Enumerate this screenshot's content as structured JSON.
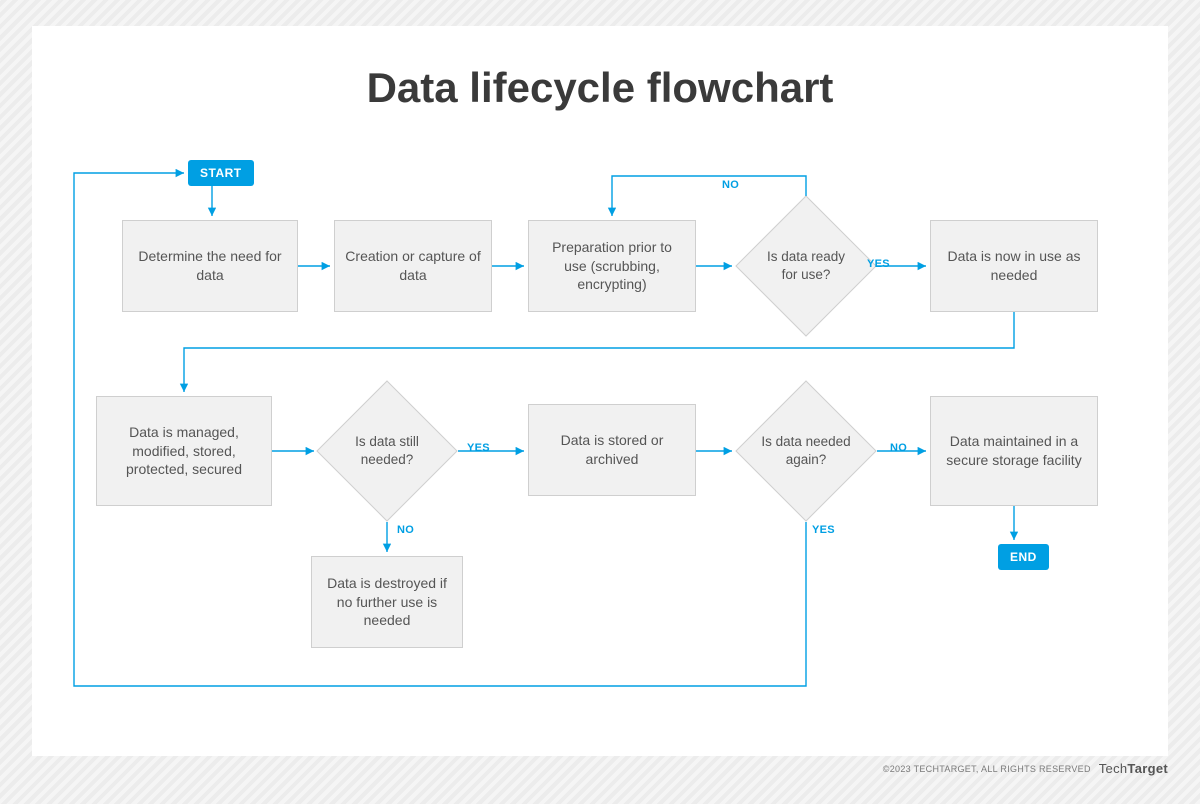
{
  "title": "Data lifecycle flowchart",
  "pills": {
    "start": "START",
    "end": "END"
  },
  "nodes": {
    "n1": "Determine the need for data",
    "n2": "Creation or capture of data",
    "n3": "Preparation prior to use (scrubbing, encrypting)",
    "d1": "Is data ready for use?",
    "n4": "Data is now in use as needed",
    "n5": "Data is managed, modified, stored, protected, secured",
    "d2": "Is data still needed?",
    "n6": "Data is stored or archived",
    "d3": "Is data needed again?",
    "n7": "Data maintained in a secure storage facility",
    "n8": "Data is destroyed if no further use is needed"
  },
  "labels": {
    "d1_yes": "YES",
    "d1_no": "NO",
    "d2_yes": "YES",
    "d2_no": "NO",
    "d3_yes": "YES",
    "d3_no": "NO"
  },
  "footer": {
    "copyright": "©2023 TECHTARGET, ALL RIGHTS RESERVED",
    "brand_light": "Tech",
    "brand_bold": "Target"
  },
  "colors": {
    "accent": "#009fe3"
  }
}
